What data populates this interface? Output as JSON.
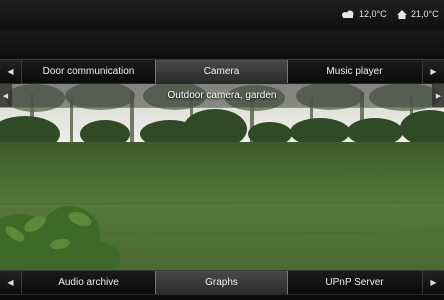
{
  "status": {
    "outdoor_temp": "12,0°C",
    "indoor_temp": "21,0°C",
    "outdoor_icon": "outdoor-weather-icon",
    "indoor_icon": "home-icon"
  },
  "top_tabs": {
    "prev_arrow": "◀",
    "next_arrow": "▶",
    "items": [
      {
        "label": "Door communication",
        "active": false
      },
      {
        "label": "Camera",
        "active": true
      },
      {
        "label": "Music player",
        "active": false
      }
    ]
  },
  "camera": {
    "prev_arrow": "◀",
    "next_arrow": "▶",
    "title": "Outdoor camera, garden"
  },
  "bottom_tabs": {
    "prev_arrow": "◀",
    "next_arrow": "▶",
    "items": [
      {
        "label": "Audio archive",
        "active": false
      },
      {
        "label": "Graphs",
        "active": true
      },
      {
        "label": "UPnP Server",
        "active": false
      }
    ]
  },
  "colors": {
    "background": "#0d0d0d",
    "active_tab": "#3a3a3a",
    "lawn": "#4d6e34"
  }
}
